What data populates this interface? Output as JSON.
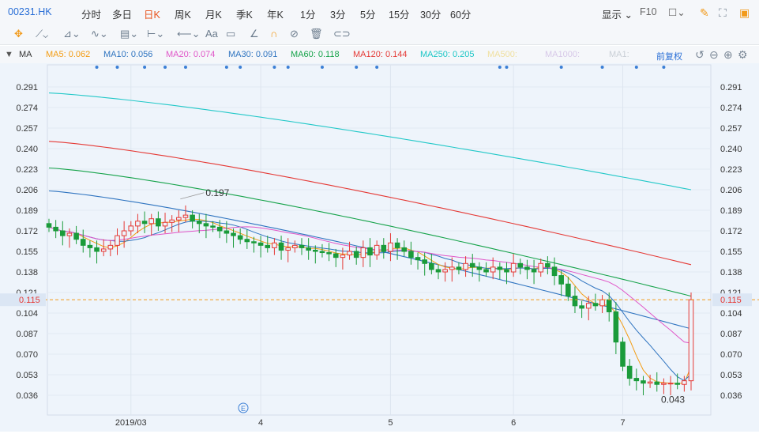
{
  "toolbar": {
    "code": "00231.HK",
    "periods": [
      "分时",
      "多日",
      "日K",
      "周K",
      "月K",
      "季K",
      "年K",
      "1分",
      "3分",
      "5分",
      "15分",
      "30分",
      "60分"
    ],
    "active_period": "日K",
    "display_label": "显示",
    "f10_label": "F10"
  },
  "indicator": {
    "name": "MA",
    "items": [
      {
        "label": "MA5: 0.062",
        "color": "#f39c12"
      },
      {
        "label": "MA10: 0.056",
        "color": "#2f74c0"
      },
      {
        "label": "MA20: 0.074",
        "color": "#e056c8"
      },
      {
        "label": "MA30: 0.091",
        "color": "#2f74c0"
      },
      {
        "label": "MA60: 0.118",
        "color": "#16a34a"
      },
      {
        "label": "MA120: 0.144",
        "color": "#e53935"
      },
      {
        "label": "MA250: 0.205",
        "color": "#1cc6c6"
      },
      {
        "label": "MA500:",
        "color": "#f0e0a0"
      },
      {
        "label": "MA1000:",
        "color": "#d7c8e8"
      },
      {
        "label": "MA1:",
        "color": "#c9cfd6"
      }
    ],
    "adjust_label": "前复权"
  },
  "chart_data": {
    "type": "candlestick",
    "y_ticks": [
      0.291,
      0.274,
      0.257,
      0.24,
      0.223,
      0.206,
      0.189,
      0.172,
      0.155,
      0.138,
      0.121,
      0.104,
      0.087,
      0.07,
      0.053,
      0.036
    ],
    "ylim": [
      0.022,
      0.305
    ],
    "x_labels": [
      {
        "label": "2019/03",
        "index": 12
      },
      {
        "label": "4",
        "index": 31
      },
      {
        "label": "5",
        "index": 50
      },
      {
        "label": "6",
        "index": 68
      },
      {
        "label": "7",
        "index": 84
      }
    ],
    "n_candles": 95,
    "current_price": "0.115",
    "annotations": [
      {
        "label": "0.197",
        "index": 19,
        "value": 0.197
      },
      {
        "label": "0.043",
        "index": 91,
        "value": 0.043
      }
    ],
    "close": [
      0.175,
      0.172,
      0.168,
      0.17,
      0.165,
      0.16,
      0.158,
      0.155,
      0.157,
      0.16,
      0.168,
      0.172,
      0.176,
      0.18,
      0.178,
      0.182,
      0.176,
      0.179,
      0.181,
      0.183,
      0.185,
      0.18,
      0.178,
      0.176,
      0.175,
      0.172,
      0.17,
      0.168,
      0.165,
      0.163,
      0.162,
      0.16,
      0.158,
      0.162,
      0.156,
      0.158,
      0.16,
      0.158,
      0.156,
      0.155,
      0.154,
      0.153,
      0.15,
      0.152,
      0.155,
      0.15,
      0.158,
      0.152,
      0.16,
      0.155,
      0.162,
      0.158,
      0.155,
      0.15,
      0.148,
      0.145,
      0.14,
      0.138,
      0.14,
      0.142,
      0.14,
      0.145,
      0.142,
      0.14,
      0.138,
      0.142,
      0.14,
      0.138,
      0.145,
      0.142,
      0.14,
      0.138,
      0.145,
      0.142,
      0.135,
      0.128,
      0.118,
      0.11,
      0.108,
      0.112,
      0.11,
      0.115,
      0.105,
      0.08,
      0.06,
      0.05,
      0.048,
      0.046,
      0.047,
      0.045,
      0.046,
      0.046,
      0.045,
      0.048,
      0.115
    ],
    "ma_lines": [
      {
        "name": "MA250",
        "color": "#22c8c8",
        "start": 0.286,
        "end": 0.206
      },
      {
        "name": "MA120",
        "color": "#e53935",
        "start": 0.246,
        "end": 0.144
      },
      {
        "name": "MA60",
        "color": "#16a34a",
        "start": 0.224,
        "end": 0.118
      },
      {
        "name": "MA30",
        "color": "#2f74c0",
        "start": 0.205,
        "end": 0.091
      }
    ]
  }
}
